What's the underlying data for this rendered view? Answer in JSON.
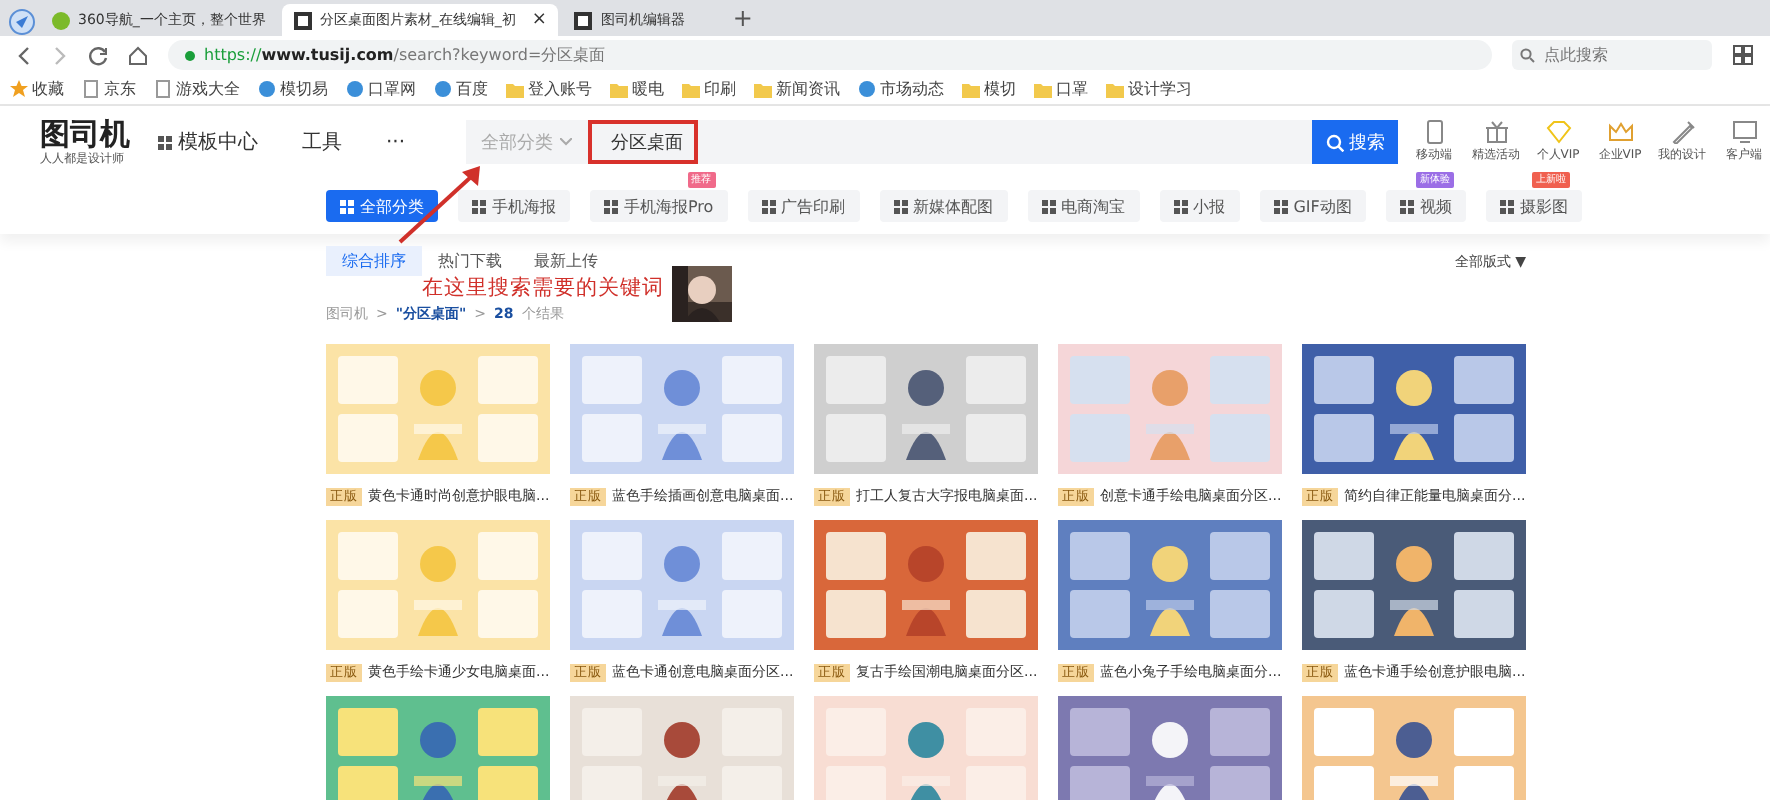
{
  "browser": {
    "tabs": [
      {
        "title": "360导航_一个主页，整个世界",
        "selected": false
      },
      {
        "title": "分区桌面图片素材_在线编辑_初",
        "selected": true,
        "close": "×"
      },
      {
        "title": "图司机编辑器",
        "selected": false
      }
    ],
    "new_tab": "+",
    "url": {
      "scheme": "https://",
      "host": "www.tusij.com",
      "path": "/search?keyword=分区桌面"
    },
    "search_placeholder": "点此搜索",
    "bookmarks": [
      {
        "label": "收藏",
        "kind": "star"
      },
      {
        "label": "京东",
        "kind": "page"
      },
      {
        "label": "游戏大全",
        "kind": "page"
      },
      {
        "label": "模切易",
        "kind": "site"
      },
      {
        "label": "口罩网",
        "kind": "site"
      },
      {
        "label": "百度",
        "kind": "site"
      },
      {
        "label": "登入账号",
        "kind": "folder"
      },
      {
        "label": "暖电",
        "kind": "folder"
      },
      {
        "label": "印刷",
        "kind": "folder"
      },
      {
        "label": "新闻资讯",
        "kind": "folder"
      },
      {
        "label": "市场动态",
        "kind": "site"
      },
      {
        "label": "模切",
        "kind": "folder"
      },
      {
        "label": "口罩",
        "kind": "folder"
      },
      {
        "label": "设计学习",
        "kind": "folder"
      }
    ]
  },
  "site": {
    "logo": "图司机",
    "tagline": "人人都是设计师",
    "nav": [
      {
        "label": "模板中心",
        "kind": "grid"
      },
      {
        "label": "工具",
        "kind": "text"
      },
      {
        "label": "···",
        "kind": "text"
      }
    ],
    "search": {
      "category": "全部分类",
      "value": "分区桌面",
      "button": "搜索"
    },
    "tools": [
      {
        "label": "移动端",
        "kind": "phone"
      },
      {
        "label": "精选活动",
        "kind": "gift"
      },
      {
        "label": "个人VIP",
        "kind": "diamond"
      },
      {
        "label": "企业VIP",
        "kind": "crown"
      },
      {
        "label": "我的设计",
        "kind": "pen"
      },
      {
        "label": "客户端",
        "kind": "monitor"
      }
    ]
  },
  "categories": [
    {
      "label": "全部分类",
      "selected": true
    },
    {
      "label": "手机海报",
      "selected": false
    },
    {
      "label": "手机海报Pro",
      "selected": false,
      "badge": "推荐",
      "color": "#f06a8a"
    },
    {
      "label": "广告印刷",
      "selected": false
    },
    {
      "label": "新媒体配图",
      "selected": false
    },
    {
      "label": "电商淘宝",
      "selected": false
    },
    {
      "label": "小报",
      "selected": false
    },
    {
      "label": "GIF动图",
      "selected": false
    },
    {
      "label": "视频",
      "selected": false,
      "badge": "新体验",
      "color": "#9b6ee6"
    },
    {
      "label": "摄影图",
      "selected": false,
      "badge": "上新啦",
      "color": "#f0604f"
    }
  ],
  "sort": [
    {
      "label": "综合排序",
      "selected": true
    },
    {
      "label": "热门下载",
      "selected": false
    },
    {
      "label": "最新上传",
      "selected": false
    }
  ],
  "layout_filter": "全部版式 ▼",
  "breadcrumb": [
    {
      "text": "图司机",
      "kind": "link"
    },
    {
      "text": ">",
      "kind": "sep"
    },
    {
      "text": "\"分区桌面\"",
      "kind": "keyword"
    },
    {
      "text": ">",
      "kind": "sep"
    },
    {
      "text": "28",
      "kind": "count"
    },
    {
      "text": "个结果",
      "kind": "plain"
    }
  ],
  "annotation": {
    "text": "在这里搜索需要的关键词",
    "kind": "picture"
  },
  "results": [
    {
      "kind": "picture",
      "badge": "正版",
      "caption": "黄色卡通时尚创意护眼电脑..."
    },
    {
      "kind": "picture",
      "badge": "正版",
      "caption": "蓝色手绘插画创意电脑桌面..."
    },
    {
      "kind": "picture",
      "badge": "正版",
      "caption": "打工人复古大字报电脑桌面..."
    },
    {
      "kind": "picture",
      "badge": "正版",
      "caption": "创意卡通手绘电脑桌面分区..."
    },
    {
      "kind": "picture",
      "badge": "正版",
      "caption": "简约自律正能量电脑桌面分..."
    },
    {
      "kind": "picture",
      "badge": "正版",
      "caption": "黄色手绘卡通少女电脑桌面..."
    },
    {
      "kind": "picture",
      "badge": "正版",
      "caption": "蓝色卡通创意电脑桌面分区..."
    },
    {
      "kind": "picture",
      "badge": "正版",
      "caption": "复古手绘国潮电脑桌面分区..."
    },
    {
      "kind": "picture",
      "badge": "正版",
      "caption": "蓝色小兔子手绘电脑桌面分..."
    },
    {
      "kind": "picture",
      "badge": "正版",
      "caption": "蓝色卡通手绘创意护眼电脑..."
    },
    {
      "kind": "picture"
    },
    {
      "kind": "picture"
    },
    {
      "kind": "picture"
    },
    {
      "kind": "picture"
    },
    {
      "kind": "picture"
    }
  ]
}
